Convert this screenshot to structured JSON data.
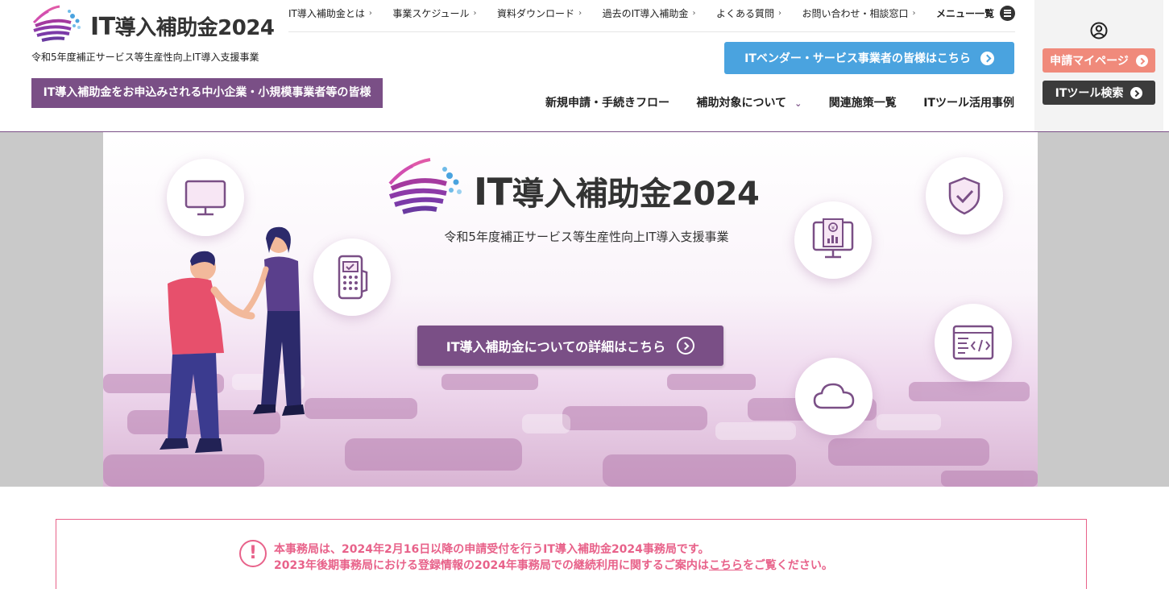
{
  "header": {
    "logo_text_it": "IT",
    "logo_text_rest": "導入補助金2024",
    "tagline": "令和5年度補正サービス等生産性向上IT導入支援事業",
    "sme_banner": "IT導入補助金をお申込みされる中小企業・小規模事業者等の皆様",
    "top_links": [
      {
        "label": "IT導入補助金とは"
      },
      {
        "label": "事業スケジュール"
      },
      {
        "label": "資料ダウンロード"
      },
      {
        "label": "過去のIT導入補助金"
      },
      {
        "label": "よくある質問"
      },
      {
        "label": "お問い合わせ・相談窓口"
      }
    ],
    "menu_label": "メニュー一覧",
    "vendor_button": "ITベンダー・サービス事業者の皆様はこちら",
    "main_nav": [
      {
        "label": "新規申請・手続きフロー"
      },
      {
        "label": "補助対象について"
      },
      {
        "label": "関連施策一覧"
      },
      {
        "label": "ITツール活用事例"
      }
    ]
  },
  "side_panel": {
    "mypage_button": "申請マイページ",
    "tool_search_button": "ITツール検索"
  },
  "hero": {
    "logo_text_it": "IT",
    "logo_text_rest": "導入補助金2024",
    "subtitle": "令和5年度補正サービス等生産性向上IT導入支援事業",
    "detail_button": "IT導入補助金についての詳細はこちら",
    "icons": [
      "monitor-icon",
      "payment-terminal-icon",
      "shield-check-icon",
      "yen-report-icon",
      "code-window-icon",
      "cloud-icon"
    ]
  },
  "notice": {
    "line1": "本事務局は、2024年2月16日以降の申請受付を行うIT導入補助金2024事務局です。",
    "line2_before": "2023年後期事務局における登録情報の2024年事務局での継続利用に関するご案内は",
    "line2_link": "こちら",
    "line2_after": "をご覧ください。"
  },
  "colors": {
    "brand_purple": "#7a4f86",
    "vendor_blue": "#4aa3df",
    "mypage_coral": "#f08a7b",
    "notice_pink": "#e8628a"
  }
}
